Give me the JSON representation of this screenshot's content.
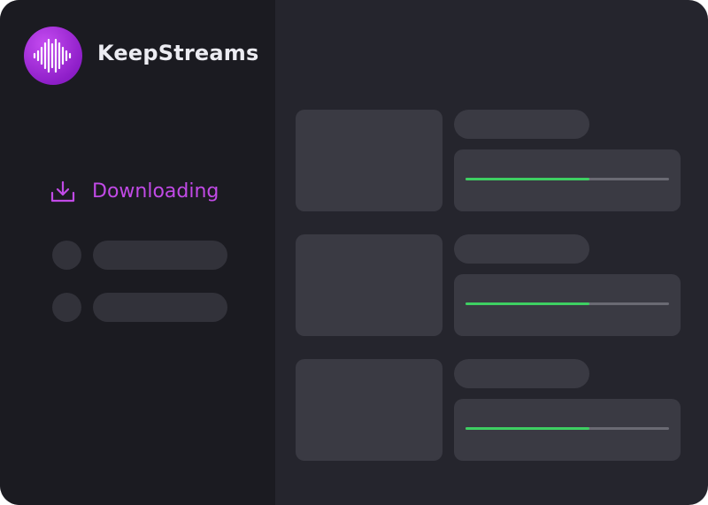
{
  "app": {
    "name": "KeepStreams",
    "logo_icon": "soundwave-icon",
    "accent": "#c14ae6"
  },
  "sidebar": {
    "items": [
      {
        "label": "Downloading",
        "icon": "download-icon",
        "active": true,
        "color": "#c14ae6"
      }
    ]
  },
  "downloads": [
    {
      "progress": 0.61,
      "progress_color": "#3ecf62"
    },
    {
      "progress": 0.61,
      "progress_color": "#3ecf62"
    },
    {
      "progress": 0.61,
      "progress_color": "#3ecf62"
    }
  ]
}
